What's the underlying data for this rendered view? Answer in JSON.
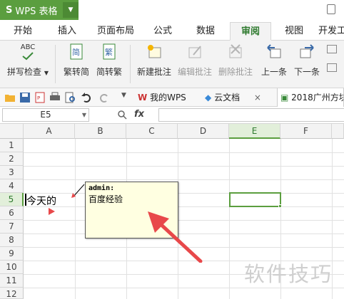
{
  "app": {
    "name": "WPS 表格"
  },
  "tabs": [
    "开始",
    "插入",
    "页面布局",
    "公式",
    "数据",
    "审阅",
    "视图",
    "开发工"
  ],
  "active_tab": "审阅",
  "ribbon": {
    "spellcheck": "拼写检查",
    "abc": "ABC",
    "to_traditional": "繁转简",
    "to_simplified": "简转繁",
    "trad_glyph": "繁",
    "simp_glyph": "简",
    "new_comment": "新建批注",
    "edit_comment": "编辑批注",
    "delete_comment": "删除批注",
    "prev": "上一条",
    "next": "下一条"
  },
  "doc_tabs": {
    "my_wps": "我的WPS",
    "cloud": "云文档",
    "file": "2018广州方块"
  },
  "formula_bar": {
    "name_box": "E5",
    "fx": "fx",
    "value": ""
  },
  "grid": {
    "columns": [
      "A",
      "B",
      "C",
      "D",
      "E",
      "F"
    ],
    "selected_column": "E",
    "rows": [
      "1",
      "2",
      "3",
      "4",
      "5",
      "6",
      "7",
      "8",
      "9",
      "10",
      "11",
      "12"
    ],
    "selected_row": "5",
    "cell_a5": "今天的"
  },
  "comment": {
    "author": "admin:",
    "text": "百度经验"
  },
  "colors": {
    "brand": "#5b9e3f",
    "comment_bg": "#ffffe1",
    "arrow": "#e8484a"
  },
  "watermark": "软件技巧"
}
